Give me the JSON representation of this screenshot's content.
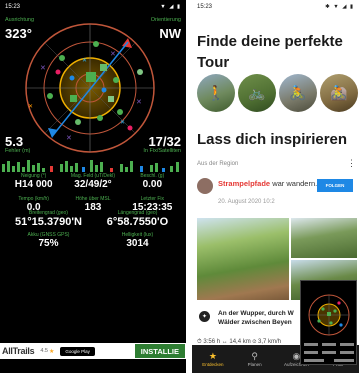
{
  "left": {
    "status_time": "15:23",
    "status_icons": "▼ ◢ ▮",
    "azimuth_label": "Ausrichtung",
    "azimuth_value": "323°",
    "direction_label": "Orientierung",
    "direction_value": "NW",
    "error_label": "Fehler (m)",
    "error_value": "5.3",
    "satellites_label": "In Fix/Satelliten",
    "satellites_value": "17/32",
    "row1_labels": [
      "Neigung (°)",
      "Mag. Feld (uT/Dekl)",
      "Beschl. (g)"
    ],
    "row1_values": [
      "H14 000",
      "32/49/2°",
      "0.00"
    ],
    "row2_labels": [
      "Tempo (km/h)",
      "Höhe über MSL",
      "Letzter Fix"
    ],
    "row2_values": [
      "0.0",
      "183",
      "15:23:35"
    ],
    "coord_labels": [
      "Breitengrad (geo)",
      "Längengrad (geo)"
    ],
    "coord_values": [
      "51°15.3790'N",
      "6°58.7550'O"
    ],
    "row4_labels": [
      "Akku (GNSS GPS)",
      "Helligkeit (lux)"
    ],
    "row4_values": [
      "75%",
      "3014"
    ],
    "ad": {
      "brand": "AllTrails",
      "rating": "4.5",
      "store": "Google Play",
      "install": "INSTALLIE"
    }
  },
  "right": {
    "status_time": "15:23",
    "status_icons": "✱ ▼ ◢ ▮",
    "heading1_line1": "Finde deine perfekte",
    "heading1_line2": "Tour",
    "categories": [
      "hiking-icon",
      "bike-icon",
      "road-bike-icon",
      "mountain-bike-icon"
    ],
    "heading2": "Lass dich inspirieren",
    "region_label": "Aus der Region",
    "author_name": "Strampelpfade",
    "author_action": "war wandern.",
    "post_date": "20. August 2020 10:2",
    "follow_button": "FOLGEN",
    "caption_line1": "An der Wupper, durch W",
    "caption_line2": "Wälder zwischen Beyen",
    "stats": "⏱ 3:56 h   ↔ 14,4 km   ⌀ 3,7 km/h",
    "nav": [
      {
        "label": "Entdecken",
        "icon": "★"
      },
      {
        "label": "Planen",
        "icon": "⚲"
      },
      {
        "label": "Aufzeichnen",
        "icon": "◉"
      },
      {
        "label": "Profil",
        "icon": "☺"
      }
    ]
  },
  "colors": {
    "radar_green": "#4caf50",
    "accent_yellow": "#fbc02d",
    "follow_blue": "#1e88e5",
    "komoot_red": "#e53935"
  }
}
